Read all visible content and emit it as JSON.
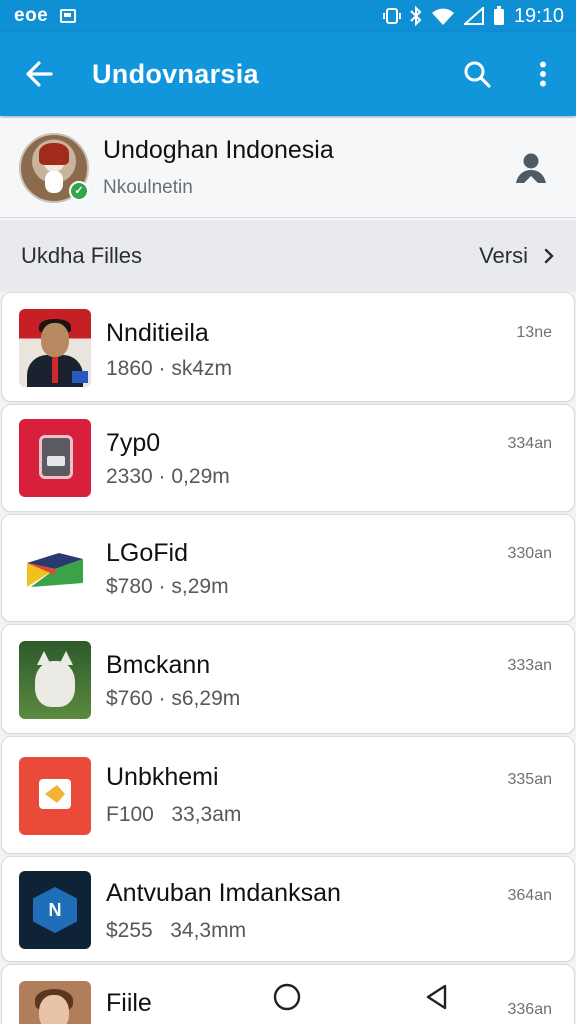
{
  "status_bar": {
    "left_text": "eoe",
    "time": "19:10"
  },
  "app_bar": {
    "title": "Undovnarsia",
    "back_icon": "arrow-left-icon",
    "search_icon": "search-icon",
    "more_icon": "more-vert-icon"
  },
  "profile": {
    "name": "Undoghan Indonesia",
    "subtitle": "Nkoulnetin",
    "action_icon": "person-icon"
  },
  "section": {
    "left": "Ukdha  Filles",
    "right": "Versi"
  },
  "items": [
    {
      "title": "Nnditieila",
      "meta": "1860 · sk4zm",
      "time": "13ne"
    },
    {
      "title": "7yp0",
      "meta": "2330 · 0,29m",
      "time": "334an"
    },
    {
      "title": "LGoFid",
      "meta": "$780 · s,29m",
      "time": "330an"
    },
    {
      "title": "Bmckann",
      "meta": "$760 · s6,29m",
      "time": "333an"
    },
    {
      "title": "Unbkhemi",
      "meta": "F100   33,3am",
      "time": "335an"
    },
    {
      "title": "Antvuban Imdanksan",
      "meta": "$255   34,3mm",
      "time": "364an"
    },
    {
      "title": "Fiile",
      "meta": "",
      "time": "336an"
    }
  ],
  "colors": {
    "primary": "#1296db",
    "status": "#0f8fd4",
    "verified": "#2fa64d"
  }
}
